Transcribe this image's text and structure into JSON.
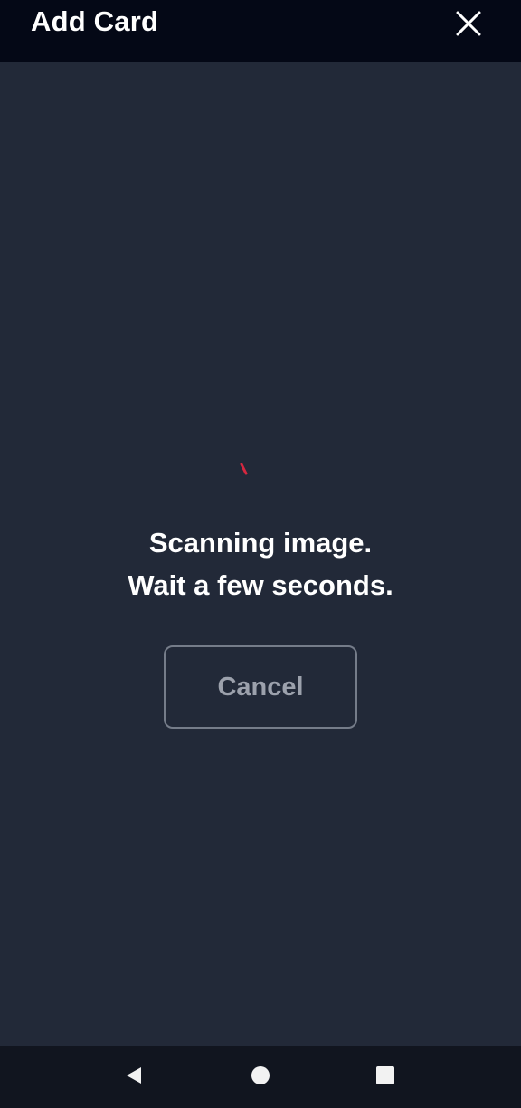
{
  "header": {
    "title": "Add Card",
    "close_icon": "close-icon"
  },
  "scan": {
    "line1": "Scanning image.",
    "line2": "Wait a few seconds.",
    "spinner_color": "#d6273f"
  },
  "actions": {
    "cancel_label": "Cancel"
  },
  "system_nav": {
    "back_icon": "back-triangle-icon",
    "home_icon": "home-circle-icon",
    "recents_icon": "recents-square-icon"
  },
  "colors": {
    "background": "#222938",
    "header_bg": "#040816",
    "nav_bg": "#11151f",
    "text": "#ffffff",
    "button_border": "#757c89",
    "button_text": "#9ca1ac"
  }
}
